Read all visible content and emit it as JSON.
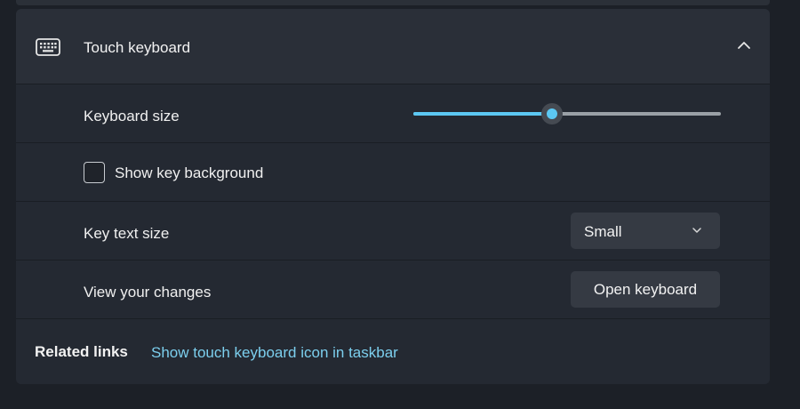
{
  "section": {
    "title": "Touch keyboard",
    "icon": "keyboard-icon",
    "expanded": true,
    "collapse_icon": "chevron-up-icon"
  },
  "keyboard_size": {
    "label": "Keyboard size",
    "value_fraction": 0.45
  },
  "key_background": {
    "label": "Show key background",
    "checked": false
  },
  "key_text_size": {
    "label": "Key text size",
    "selected": "Small",
    "dropdown_icon": "chevron-down-icon"
  },
  "view_changes": {
    "label": "View your changes",
    "button_label": "Open keyboard"
  },
  "related": {
    "label": "Related links",
    "link_text": "Show touch keyboard icon in taskbar"
  },
  "colors": {
    "accent": "#5cc8f3",
    "link": "#7ccfee",
    "card": "#242932",
    "background": "#1c2027"
  }
}
